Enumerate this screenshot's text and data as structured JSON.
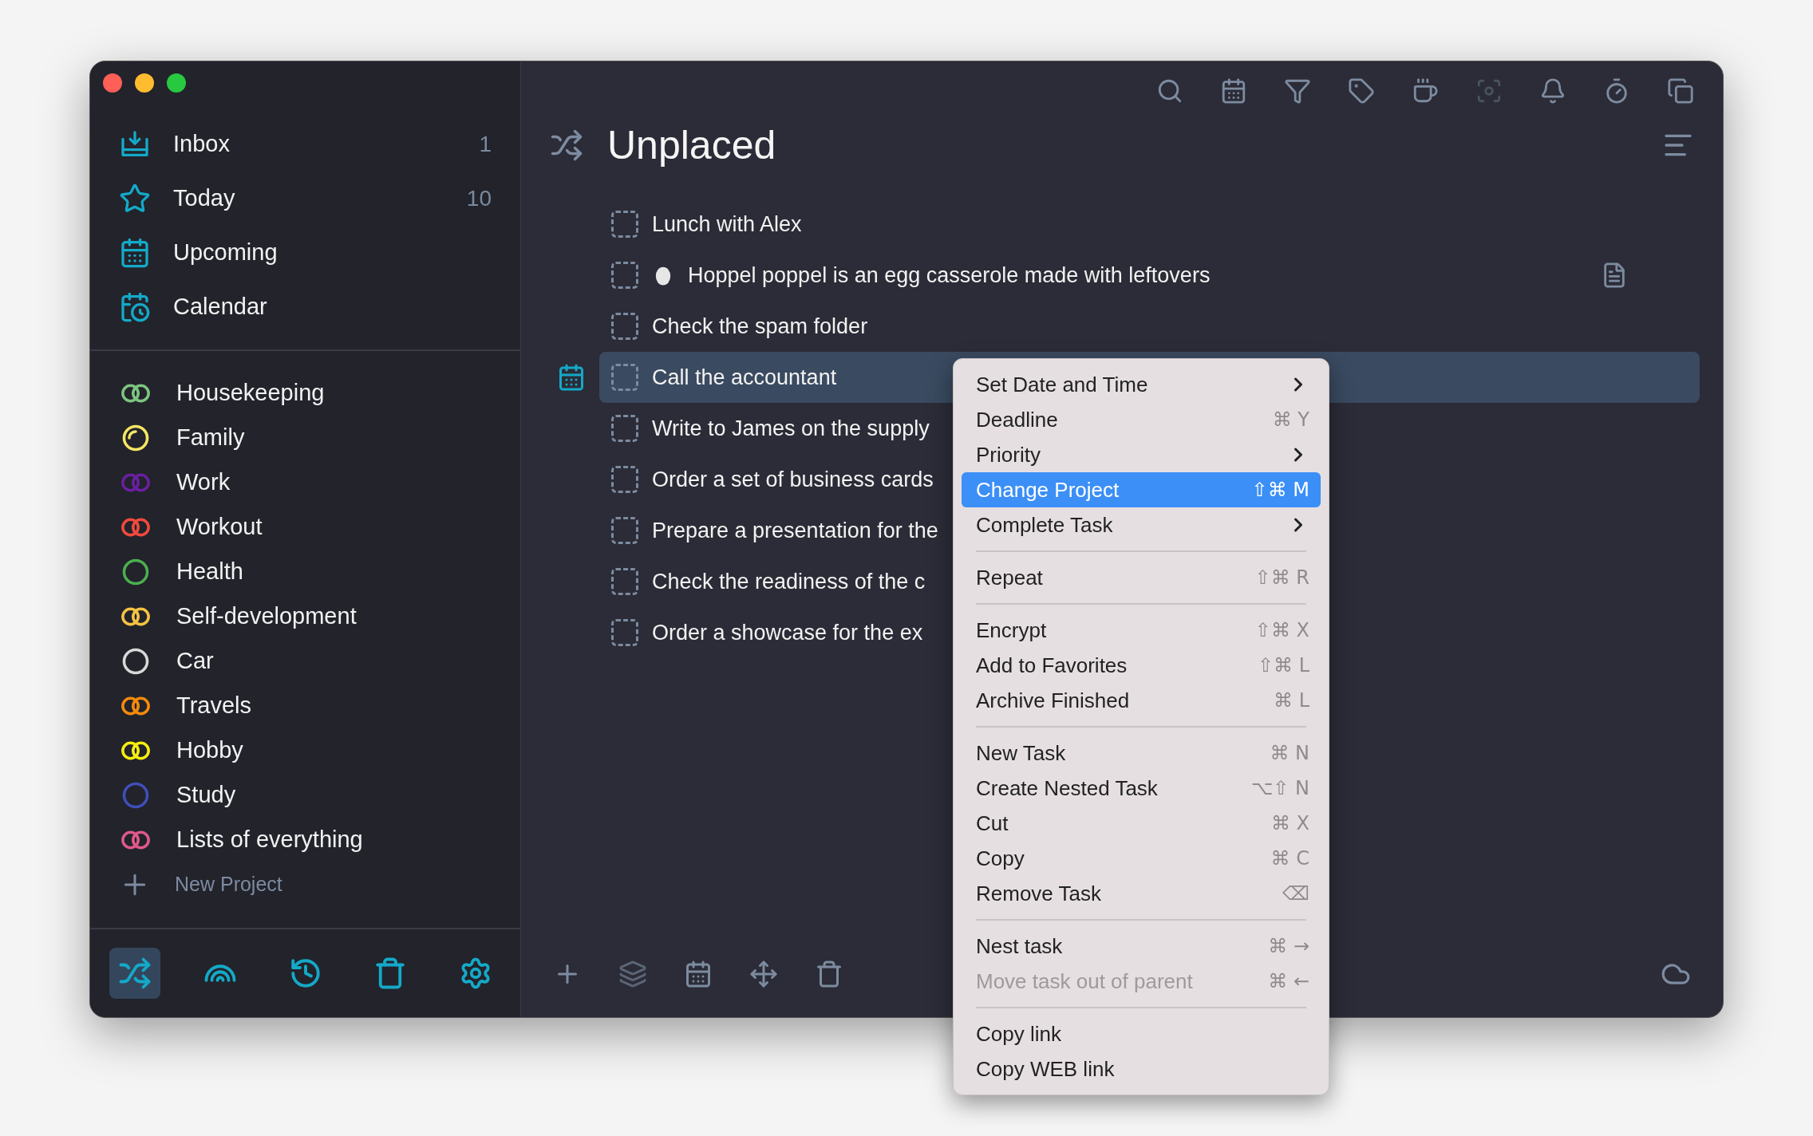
{
  "sidebar": {
    "nav": [
      {
        "label": "Inbox",
        "count": "1"
      },
      {
        "label": "Today",
        "count": "10"
      },
      {
        "label": "Upcoming"
      },
      {
        "label": "Calendar"
      }
    ],
    "projects": [
      {
        "name": "Housekeeping",
        "kind": "linked",
        "color": "#7cc47f"
      },
      {
        "name": "Family",
        "kind": "partial",
        "color": "#f5e663"
      },
      {
        "name": "Work",
        "kind": "linked",
        "color": "#6a1fa0"
      },
      {
        "name": "Workout",
        "kind": "linked",
        "color": "#f04a3c"
      },
      {
        "name": "Health",
        "kind": "circle",
        "color": "#4caf50"
      },
      {
        "name": "Self-development",
        "kind": "linked",
        "color": "#f5c242"
      },
      {
        "name": "Car",
        "kind": "circle",
        "color": "#d8d8d8"
      },
      {
        "name": "Travels",
        "kind": "linked",
        "color": "#f58a0b"
      },
      {
        "name": "Hobby",
        "kind": "linked",
        "color": "#f5ee10"
      },
      {
        "name": "Study",
        "kind": "circle",
        "color": "#3f4fb8"
      },
      {
        "name": "Lists of everything",
        "kind": "linked",
        "color": "#e0588a"
      }
    ],
    "new_project": "New Project",
    "footer_tabs": [
      {
        "selected": true
      },
      {
        "selected": false
      },
      {
        "selected": false
      },
      {
        "selected": false
      },
      {
        "selected": false
      }
    ]
  },
  "toolbar": [
    {
      "disabled": false
    },
    {
      "disabled": false
    },
    {
      "disabled": false
    },
    {
      "disabled": false
    },
    {
      "disabled": false
    },
    {
      "disabled": true
    },
    {
      "disabled": false
    },
    {
      "disabled": false
    },
    {
      "disabled": false
    }
  ],
  "main": {
    "title": "Unplaced",
    "tasks": [
      {
        "text": "Lunch with Alex",
        "selected": false
      },
      {
        "text": "Hoppel poppel is an egg casserole made with leftovers",
        "selected": false,
        "has_icon": true,
        "has_note": true
      },
      {
        "text": "Check the spam folder",
        "selected": false
      },
      {
        "text": "Call the accountant",
        "selected": true
      },
      {
        "text": "Write to James on the supply",
        "selected": false
      },
      {
        "text": "Order a set of business cards",
        "selected": false
      },
      {
        "text": "Prepare a presentation for the",
        "selected": false
      },
      {
        "text": "Check the readiness of the c",
        "selected": false
      },
      {
        "text": "Order a showcase for the ex",
        "selected": false
      }
    ]
  },
  "context_menu": {
    "items": [
      {
        "kind": "item",
        "label": "Set Date and Time",
        "submenu": true,
        "selected": false,
        "disabled": false
      },
      {
        "kind": "item",
        "label": "Deadline",
        "shortcut": "⌘ Y",
        "selected": false,
        "disabled": false
      },
      {
        "kind": "item",
        "label": "Priority",
        "submenu": true,
        "selected": false,
        "disabled": false
      },
      {
        "kind": "item",
        "label": "Change Project",
        "shortcut": "⇧⌘ M",
        "selected": true,
        "disabled": false
      },
      {
        "kind": "item",
        "label": "Complete Task",
        "submenu": true,
        "selected": false,
        "disabled": false
      },
      {
        "kind": "separator"
      },
      {
        "kind": "item",
        "label": "Repeat",
        "shortcut": "⇧⌘ R",
        "selected": false,
        "disabled": false
      },
      {
        "kind": "separator"
      },
      {
        "kind": "item",
        "label": "Encrypt",
        "shortcut": "⇧⌘ X",
        "selected": false,
        "disabled": false
      },
      {
        "kind": "item",
        "label": "Add to Favorites",
        "shortcut": "⇧⌘ L",
        "selected": false,
        "disabled": false
      },
      {
        "kind": "item",
        "label": "Archive Finished",
        "shortcut": "⌘ L",
        "selected": false,
        "disabled": false
      },
      {
        "kind": "separator"
      },
      {
        "kind": "item",
        "label": "New Task",
        "shortcut": "⌘ N",
        "selected": false,
        "disabled": false
      },
      {
        "kind": "item",
        "label": "Create Nested Task",
        "shortcut": "⌥⇧ N",
        "selected": false,
        "disabled": false
      },
      {
        "kind": "item",
        "label": "Cut",
        "shortcut": "⌘ X",
        "selected": false,
        "disabled": false
      },
      {
        "kind": "item",
        "label": "Copy",
        "shortcut": "⌘ C",
        "selected": false,
        "disabled": false
      },
      {
        "kind": "item",
        "label": "Remove Task",
        "shortcut": "⌫",
        "selected": false,
        "disabled": false
      },
      {
        "kind": "separator"
      },
      {
        "kind": "item",
        "label": "Nest task",
        "shortcut": "⌘ →",
        "selected": false,
        "disabled": false
      },
      {
        "kind": "item",
        "label": "Move task out of parent",
        "shortcut": "⌘ ←",
        "selected": false,
        "disabled": true
      },
      {
        "kind": "separator"
      },
      {
        "kind": "item",
        "label": "Copy link",
        "selected": false,
        "disabled": false
      },
      {
        "kind": "item",
        "label": "Copy WEB link",
        "selected": false,
        "disabled": false
      }
    ]
  }
}
